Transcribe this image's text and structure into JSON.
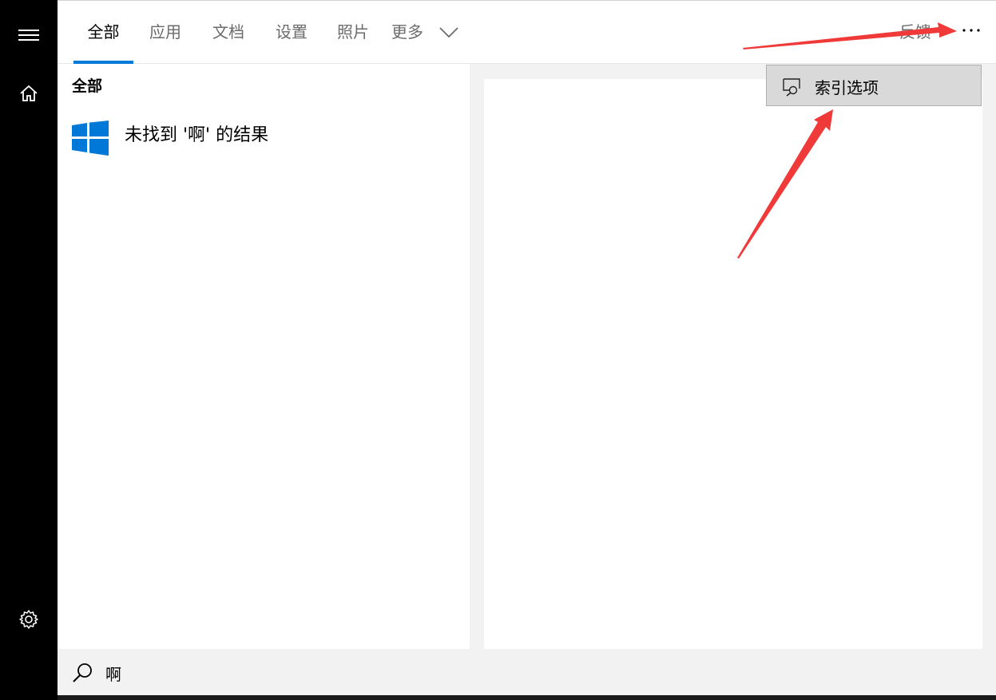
{
  "sidebar": {
    "items": [
      {
        "name": "menu",
        "icon": "hamburger-icon"
      },
      {
        "name": "home",
        "icon": "home-icon"
      },
      {
        "name": "settings",
        "icon": "gear-icon"
      }
    ]
  },
  "header": {
    "tabs": [
      {
        "label": "全部",
        "active": true
      },
      {
        "label": "应用",
        "active": false
      },
      {
        "label": "文档",
        "active": false
      },
      {
        "label": "设置",
        "active": false
      },
      {
        "label": "照片",
        "active": false
      },
      {
        "label": "更多",
        "active": false
      }
    ],
    "feedback_label": "反馈",
    "more_icon": "ellipsis-icon"
  },
  "results": {
    "section_title": "全部",
    "no_result_text": "未找到 '啊' 的结果",
    "icon": "windows-logo-icon"
  },
  "dropdown": {
    "items": [
      {
        "label": "索引选项",
        "icon": "index-options-icon"
      }
    ]
  },
  "search": {
    "value": "啊",
    "icon": "search-icon"
  },
  "colors": {
    "accent": "#0078d7",
    "annotation": "#f03a3a",
    "sidebar_bg": "#000000",
    "dropdown_bg": "#d9d9d9"
  }
}
